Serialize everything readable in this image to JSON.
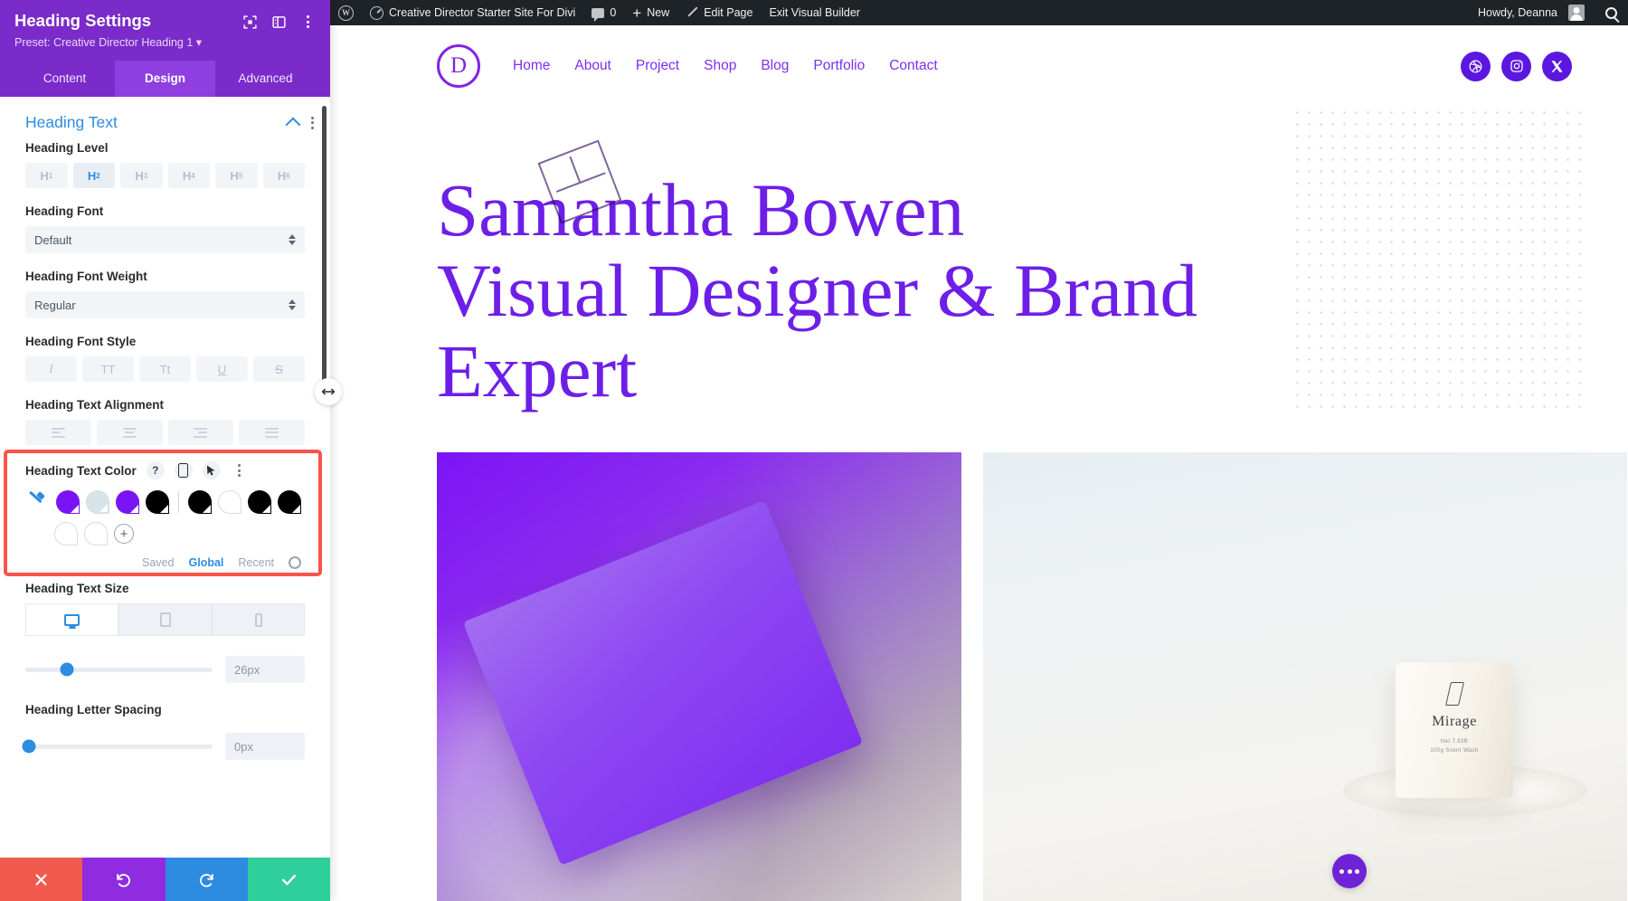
{
  "wp_admin_bar": {
    "logo_icon": "wordpress-logo-icon",
    "site_name": "Creative Director Starter Site For Divi",
    "comments_count": "0",
    "new_label": "New",
    "edit_page_label": "Edit Page",
    "exit_builder_label": "Exit Visual Builder",
    "howdy": "Howdy, Deanna",
    "search_icon": "search-icon"
  },
  "site": {
    "logo_letter": "D",
    "nav": [
      {
        "label": "Home"
      },
      {
        "label": "About"
      },
      {
        "label": "Project"
      },
      {
        "label": "Shop"
      },
      {
        "label": "Blog"
      },
      {
        "label": "Portfolio"
      },
      {
        "label": "Contact"
      }
    ],
    "socials": [
      {
        "name": "dribbble-icon"
      },
      {
        "name": "instagram-icon"
      },
      {
        "name": "x-twitter-icon"
      }
    ],
    "heading_line1": "Samantha Bowen",
    "heading_line2": "Visual Designer & Brand",
    "heading_line3": "Expert",
    "heading_color": "#6d1fe8",
    "product": {
      "brand": "Mirage",
      "sub1": "Net 7.83B",
      "sub2": "100g Scent Wash"
    },
    "fab_icon": "more-options-icon"
  },
  "panel": {
    "title": "Heading Settings",
    "preset": "Preset: Creative Director Heading 1",
    "head_icons": [
      {
        "name": "focus-target-icon"
      },
      {
        "name": "panel-layout-icon"
      },
      {
        "name": "more-vertical-icon"
      }
    ],
    "tabs": [
      {
        "label": "Content",
        "active": false
      },
      {
        "label": "Design",
        "active": true
      },
      {
        "label": "Advanced",
        "active": false
      }
    ],
    "section": {
      "title": "Heading Text",
      "collapse_icon": "chevron-up-icon",
      "more_icon": "more-vertical-icon"
    },
    "heading_level": {
      "label": "Heading Level",
      "options": [
        "H1",
        "H2",
        "H3",
        "H4",
        "H5",
        "H6"
      ],
      "selected": "H2"
    },
    "heading_font": {
      "label": "Heading Font",
      "value": "Default"
    },
    "heading_font_weight": {
      "label": "Heading Font Weight",
      "value": "Regular"
    },
    "heading_font_style": {
      "label": "Heading Font Style",
      "options": [
        {
          "glyph": "I",
          "name": "italic-icon"
        },
        {
          "glyph": "TT",
          "name": "uppercase-icon"
        },
        {
          "glyph": "Tt",
          "name": "small-caps-icon"
        },
        {
          "glyph": "U",
          "name": "underline-icon"
        },
        {
          "glyph": "S",
          "name": "strikethrough-icon"
        }
      ]
    },
    "heading_alignment": {
      "label": "Heading Text Alignment",
      "options": [
        "align-left",
        "align-center",
        "align-right",
        "align-justify"
      ]
    },
    "heading_text_color": {
      "label": "Heading Text Color",
      "help_icon": "help-icon",
      "responsive_icon": "responsive-phone-icon",
      "hover_icon": "hover-cursor-icon",
      "more_icon": "more-vertical-icon",
      "eyedropper_icon": "eyedropper-icon",
      "swatches_row1": [
        {
          "color": "#7b14f5",
          "selected": true
        },
        {
          "color": "#d6e3e8",
          "selected": true
        },
        {
          "color": "#7b14f5",
          "selected": true
        },
        {
          "color": "#000000",
          "selected": true
        },
        {
          "divider": true
        },
        {
          "color": "#000000",
          "selected": true
        },
        {
          "color": "#ffffff",
          "selected": false
        },
        {
          "color": "#000000",
          "selected": true
        },
        {
          "color": "#000000",
          "selected": true
        }
      ],
      "swatches_row2": [
        {
          "color": "#ffffff",
          "selected": false
        },
        {
          "color": "#ffffff",
          "selected": false
        }
      ],
      "add_label": "+",
      "tabs": [
        {
          "label": "Saved",
          "active": false
        },
        {
          "label": "Global",
          "active": true
        },
        {
          "label": "Recent",
          "active": false
        }
      ],
      "settings_icon": "gear-icon"
    },
    "heading_text_size": {
      "label": "Heading Text Size",
      "devices": [
        {
          "name": "desktop-icon",
          "active": true
        },
        {
          "name": "tablet-icon",
          "active": false
        },
        {
          "name": "phone-icon",
          "active": false
        }
      ],
      "value": "26px",
      "slider_percent": 22
    },
    "heading_letter_spacing": {
      "label": "Heading Letter Spacing",
      "value": "0px"
    },
    "actions": [
      {
        "name": "cancel-button",
        "icon": "close-icon",
        "color": "#f15a4f"
      },
      {
        "name": "undo-button",
        "icon": "undo-icon",
        "color": "#8f2ce0"
      },
      {
        "name": "redo-button",
        "icon": "redo-icon",
        "color": "#2d8ce0"
      },
      {
        "name": "save-button",
        "icon": "check-icon",
        "color": "#2ecf9a"
      }
    ],
    "resize_handle_icon": "horizontal-resize-icon",
    "highlight_color": "#f9534a"
  }
}
